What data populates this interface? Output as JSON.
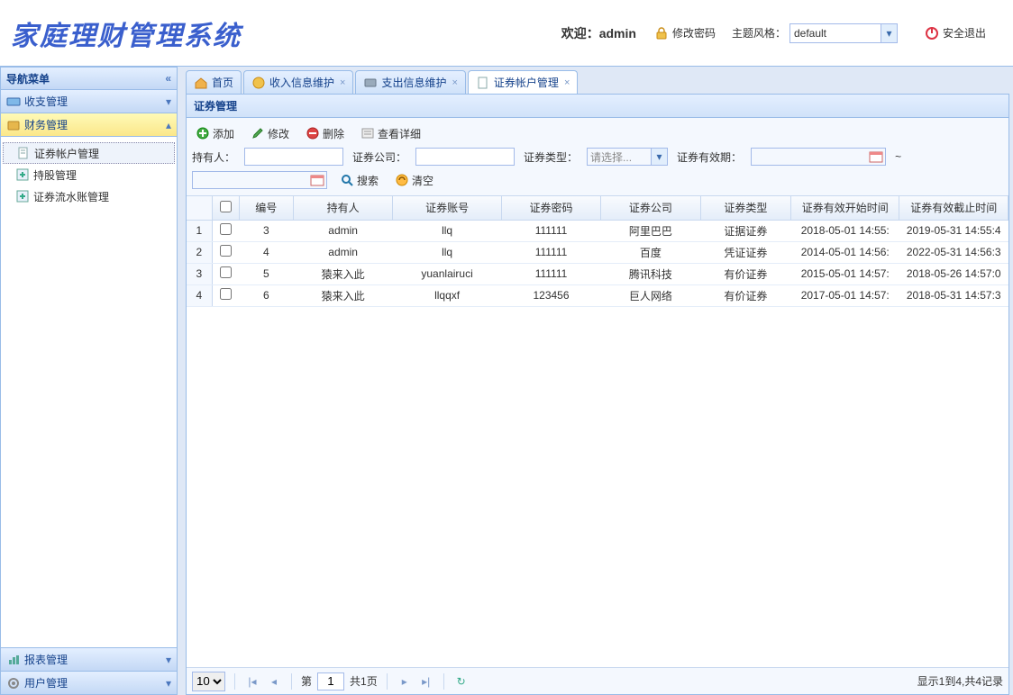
{
  "header": {
    "app_title": "家庭理财管理系统",
    "welcome_prefix": "欢迎：",
    "welcome_user": "admin",
    "change_pwd": "修改密码",
    "theme_label": "主题风格：",
    "theme_value": "default",
    "logout": "安全退出"
  },
  "sidebar": {
    "title": "导航菜单",
    "groups": [
      {
        "label": "收支管理"
      },
      {
        "label": "财务管理"
      },
      {
        "label": "报表管理"
      },
      {
        "label": "用户管理"
      }
    ],
    "finance_items": [
      {
        "label": "证券帐户管理"
      },
      {
        "label": "持股管理"
      },
      {
        "label": "证券流水账管理"
      }
    ]
  },
  "tabs": [
    {
      "label": "首页",
      "closable": false
    },
    {
      "label": "收入信息维护",
      "closable": true
    },
    {
      "label": "支出信息维护",
      "closable": true
    },
    {
      "label": "证券帐户管理",
      "closable": true
    }
  ],
  "panel": {
    "title": "证券管理",
    "toolbar": {
      "add": "添加",
      "edit": "修改",
      "delete": "删除",
      "detail": "查看详细",
      "owner_label": "持有人：",
      "company_label": "证券公司：",
      "type_label": "证券类型：",
      "type_placeholder": "请选择...",
      "valid_label": "证券有效期：",
      "tilde": "~",
      "search": "搜索",
      "clear": "清空"
    },
    "columns": [
      "编号",
      "持有人",
      "证券账号",
      "证券密码",
      "证券公司",
      "证券类型",
      "证券有效开始时间",
      "证券有效截止时间"
    ],
    "rows": [
      {
        "n": 1,
        "id": "3",
        "owner": "admin",
        "acct": "llq",
        "pwd": "111111",
        "company": "阿里巴巴",
        "type": "证据证券",
        "start": "2018-05-01 14:55:",
        "end": "2019-05-31 14:55:4"
      },
      {
        "n": 2,
        "id": "4",
        "owner": "admin",
        "acct": "llq",
        "pwd": "111111",
        "company": "百度",
        "type": "凭证证券",
        "start": "2014-05-01 14:56:",
        "end": "2022-05-31 14:56:3"
      },
      {
        "n": 3,
        "id": "5",
        "owner": "猿来入此",
        "acct": "yuanlairuci",
        "pwd": "111111",
        "company": "腾讯科技",
        "type": "有价证券",
        "start": "2015-05-01 14:57:",
        "end": "2018-05-26 14:57:0"
      },
      {
        "n": 4,
        "id": "6",
        "owner": "猿来入此",
        "acct": "llqqxf",
        "pwd": "123456",
        "company": "巨人网络",
        "type": "有价证券",
        "start": "2017-05-01 14:57:",
        "end": "2018-05-31 14:57:3"
      }
    ],
    "pager": {
      "size": "10",
      "page_label_prefix": "第",
      "page_value": "1",
      "page_label_suffix": "共1页",
      "info": "显示1到4,共4记录"
    }
  }
}
